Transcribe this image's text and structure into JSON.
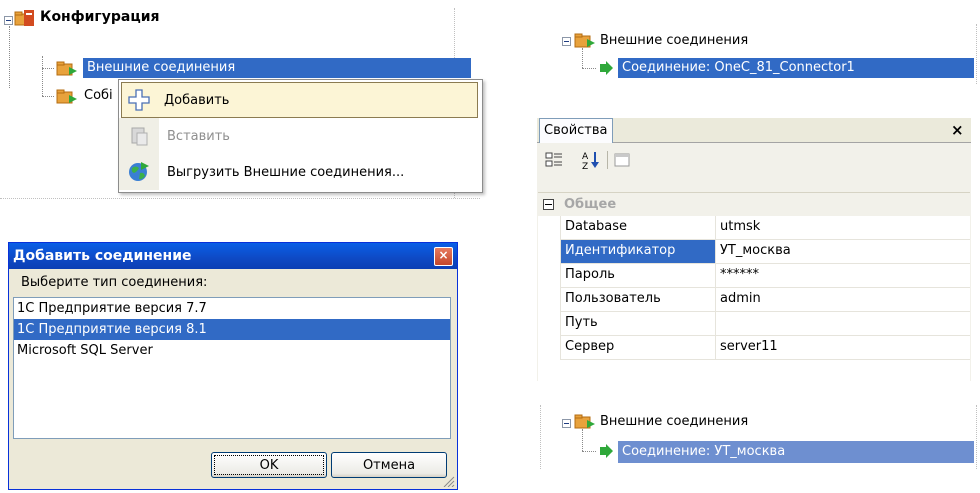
{
  "tree_top": {
    "root_label": "Конфигурация",
    "item1_label": "Внешние соединения",
    "item2_label_visible": "Собі"
  },
  "context_menu": {
    "items": [
      {
        "label": "Добавить",
        "enabled": true,
        "icon": "add-icon"
      },
      {
        "label": "Вставить",
        "enabled": false,
        "icon": "paste-icon"
      },
      {
        "label": "Выгрузить Внешние соединения...",
        "enabled": true,
        "icon": "globe-export-icon"
      }
    ]
  },
  "add_dialog": {
    "title": "Добавить соединение",
    "close_glyph": "×",
    "prompt": "Выберите тип соединения:",
    "options": [
      "1C Предприятие версия 7.7",
      "1C Предприятие версия 8.1",
      "Microsoft SQL Server"
    ],
    "selected_index": 1,
    "ok_label": "OK",
    "cancel_label": "Отмена"
  },
  "tree_right_top": {
    "parent_label": "Внешние соединения",
    "child_label": "Соединение: OneC_81_Connector1"
  },
  "properties": {
    "tab_label": "Свойства",
    "close_glyph": "×",
    "group_label": "Общее",
    "rows": [
      {
        "key": "Database",
        "value": "utmsk"
      },
      {
        "key": "Идентификатор",
        "value": "УТ_москва"
      },
      {
        "key": "Пароль",
        "value": "******"
      },
      {
        "key": "Пользователь",
        "value": "admin"
      },
      {
        "key": "Путь",
        "value": ""
      },
      {
        "key": "Сервер",
        "value": "server11"
      }
    ],
    "selected_key_index": 1
  },
  "tree_right_bottom": {
    "parent_label": "Внешние соединения",
    "child_label": "Соединение: УТ_москва"
  },
  "colors": {
    "selection": "#316ac5",
    "selection_light": "#6e8fd0",
    "folder": "#e8a23c",
    "arrow": "#2fa83a"
  }
}
